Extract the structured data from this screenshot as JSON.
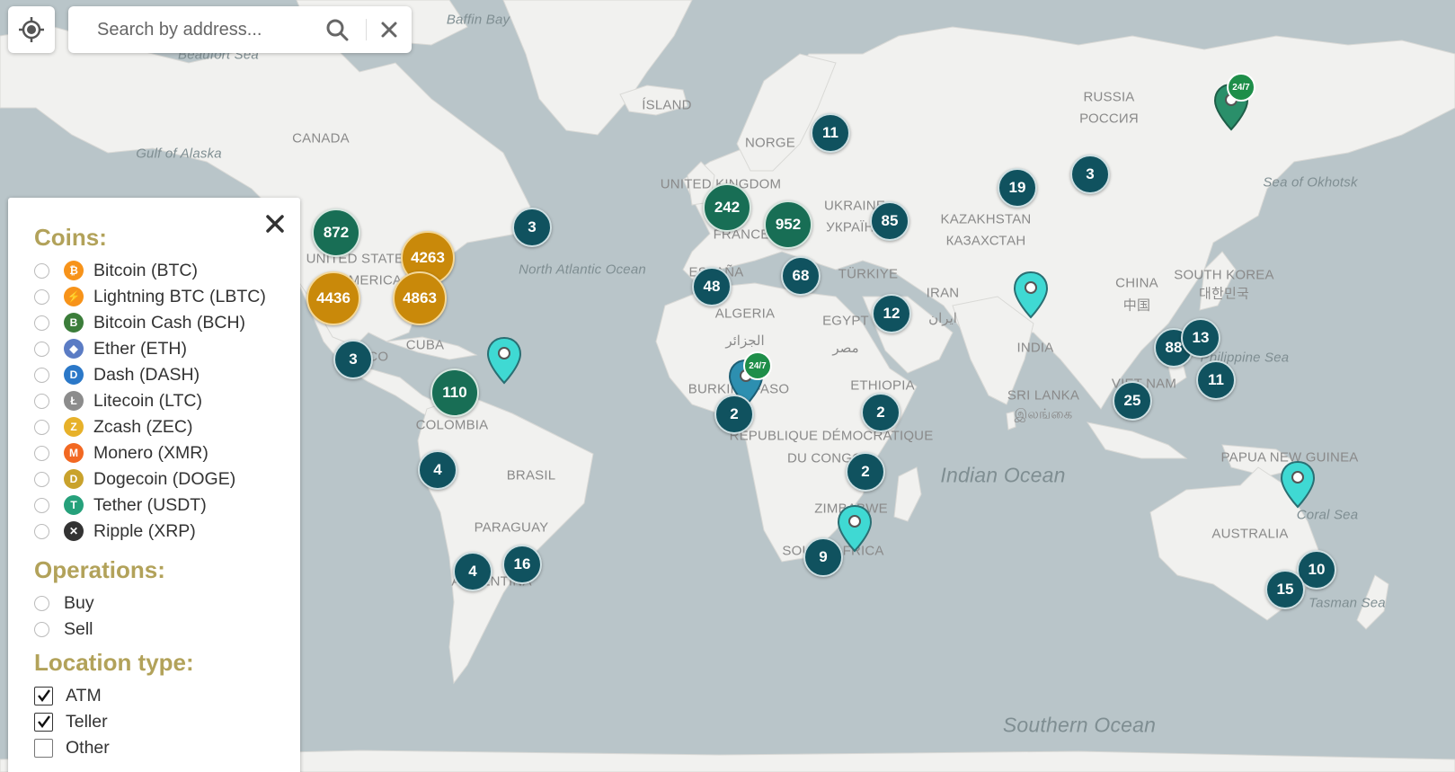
{
  "search": {
    "placeholder": "Search by address..."
  },
  "filter_panel": {
    "coins_heading": "Coins:",
    "coins": [
      {
        "label": "Bitcoin (BTC)",
        "icon": "bitcoin-icon",
        "color": "#f7931a",
        "glyph": "₿"
      },
      {
        "label": "Lightning BTC (LBTC)",
        "icon": "lightning-icon",
        "color": "#f7931a",
        "glyph": "⚡"
      },
      {
        "label": "Bitcoin Cash (BCH)",
        "icon": "bitcoin-cash-icon",
        "color": "#3b7d3a",
        "glyph": "B"
      },
      {
        "label": "Ether (ETH)",
        "icon": "ether-icon",
        "color": "#5b7cc4",
        "glyph": "◆"
      },
      {
        "label": "Dash (DASH)",
        "icon": "dash-icon",
        "color": "#2b78c8",
        "glyph": "D"
      },
      {
        "label": "Litecoin (LTC)",
        "icon": "litecoin-icon",
        "color": "#8c8c8c",
        "glyph": "Ł"
      },
      {
        "label": "Zcash (ZEC)",
        "icon": "zcash-icon",
        "color": "#e7b12a",
        "glyph": "Z"
      },
      {
        "label": "Monero (XMR)",
        "icon": "monero-icon",
        "color": "#f26822",
        "glyph": "M"
      },
      {
        "label": "Dogecoin (DOGE)",
        "icon": "dogecoin-icon",
        "color": "#c9a22c",
        "glyph": "D"
      },
      {
        "label": "Tether (USDT)",
        "icon": "tether-icon",
        "color": "#26a17b",
        "glyph": "T"
      },
      {
        "label": "Ripple (XRP)",
        "icon": "ripple-icon",
        "color": "#333333",
        "glyph": "✕"
      }
    ],
    "operations_heading": "Operations:",
    "operations": [
      {
        "label": "Buy"
      },
      {
        "label": "Sell"
      }
    ],
    "location_heading": "Location type:",
    "location_types": [
      {
        "label": "ATM",
        "checked": true
      },
      {
        "label": "Teller",
        "checked": true
      },
      {
        "label": "Other",
        "checked": false
      }
    ]
  },
  "map_labels": [
    {
      "text": "Baffin Bay",
      "kind": "sea"
    },
    {
      "text": "Beaufort Sea",
      "kind": "sea"
    },
    {
      "text": "ÍSLAND",
      "kind": "country"
    },
    {
      "text": "CANADA",
      "kind": "country"
    },
    {
      "text": "Gulf of Alaska",
      "kind": "sea"
    },
    {
      "text": "RUSSIA",
      "kind": "country"
    },
    {
      "text": "РОССИЯ",
      "kind": "country"
    },
    {
      "text": "Sea of Okhotsk",
      "kind": "sea"
    },
    {
      "text": "NORGE",
      "kind": "country"
    },
    {
      "text": "UNITED KINGDOM",
      "kind": "country"
    },
    {
      "text": "UKRAINE",
      "kind": "country"
    },
    {
      "text": "УКРАЇНА",
      "kind": "country"
    },
    {
      "text": "KAZAKHSTAN",
      "kind": "country"
    },
    {
      "text": "КАЗАХСТАН",
      "kind": "country"
    },
    {
      "text": "FRANCE",
      "kind": "country"
    },
    {
      "text": "UNITED STATES",
      "kind": "country"
    },
    {
      "text": "OF AMERICA",
      "kind": "country"
    },
    {
      "text": "North Atlantic Ocean",
      "kind": "sea"
    },
    {
      "text": "ESPAÑA",
      "kind": "country"
    },
    {
      "text": "TÜRKIYE",
      "kind": "country"
    },
    {
      "text": "CHINA",
      "kind": "country"
    },
    {
      "text": "中国",
      "kind": "country"
    },
    {
      "text": "SOUTH KOREA",
      "kind": "country"
    },
    {
      "text": "대한민국",
      "kind": "country"
    },
    {
      "text": "ALGERIA",
      "kind": "country"
    },
    {
      "text": "الجزائر",
      "kind": "country"
    },
    {
      "text": "EGYPT",
      "kind": "country"
    },
    {
      "text": "مصر",
      "kind": "country"
    },
    {
      "text": "IRAN",
      "kind": "country"
    },
    {
      "text": "ایران",
      "kind": "country"
    },
    {
      "text": "INDIA",
      "kind": "country"
    },
    {
      "text": "MEXICO",
      "kind": "country"
    },
    {
      "text": "CUBA",
      "kind": "country"
    },
    {
      "text": "Philippine Sea",
      "kind": "sea"
    },
    {
      "text": "BURKINA FASO",
      "kind": "country"
    },
    {
      "text": "ETHIOPIA",
      "kind": "country"
    },
    {
      "text": "SRI LANKA",
      "kind": "country"
    },
    {
      "text": "இலங்கை",
      "kind": "country"
    },
    {
      "text": "VIET NAM",
      "kind": "country"
    },
    {
      "text": "COLOMBIA",
      "kind": "country"
    },
    {
      "text": "RÉPUBLIQUE DÉMOCRATIQUE",
      "kind": "country"
    },
    {
      "text": "DU CONGO",
      "kind": "country"
    },
    {
      "text": "Indian Ocean",
      "kind": "ocean"
    },
    {
      "text": "BRASIL",
      "kind": "country"
    },
    {
      "text": "PAPUA NEW GUINEA",
      "kind": "country"
    },
    {
      "text": "ZIMBABWE",
      "kind": "country"
    },
    {
      "text": "Coral Sea",
      "kind": "sea"
    },
    {
      "text": "PARAGUAY",
      "kind": "country"
    },
    {
      "text": "AUSTRALIA",
      "kind": "country"
    },
    {
      "text": "SOUTH AFRICA",
      "kind": "country"
    },
    {
      "text": "ARGENTINA",
      "kind": "country"
    },
    {
      "text": "Tasman Sea",
      "kind": "sea"
    },
    {
      "text": "Southern Ocean",
      "kind": "ocean"
    }
  ],
  "clusters": [
    {
      "count": "872",
      "style": "green"
    },
    {
      "count": "4263",
      "style": "orange"
    },
    {
      "count": "4436",
      "style": "orange"
    },
    {
      "count": "4863",
      "style": "orange"
    },
    {
      "count": "3",
      "style": "teal"
    },
    {
      "count": "3",
      "style": "teal"
    },
    {
      "count": "110",
      "style": "green"
    },
    {
      "count": "4",
      "style": "teal"
    },
    {
      "count": "4",
      "style": "teal"
    },
    {
      "count": "16",
      "style": "teal"
    },
    {
      "count": "11",
      "style": "teal"
    },
    {
      "count": "242",
      "style": "green"
    },
    {
      "count": "952",
      "style": "green"
    },
    {
      "count": "85",
      "style": "teal"
    },
    {
      "count": "19",
      "style": "teal"
    },
    {
      "count": "3",
      "style": "teal"
    },
    {
      "count": "48",
      "style": "teal"
    },
    {
      "count": "68",
      "style": "teal"
    },
    {
      "count": "12",
      "style": "teal"
    },
    {
      "count": "88",
      "style": "teal"
    },
    {
      "count": "13",
      "style": "teal"
    },
    {
      "count": "11",
      "style": "teal"
    },
    {
      "count": "25",
      "style": "teal"
    },
    {
      "count": "2",
      "style": "teal"
    },
    {
      "count": "2",
      "style": "teal"
    },
    {
      "count": "2",
      "style": "teal"
    },
    {
      "count": "9",
      "style": "teal"
    },
    {
      "count": "10",
      "style": "teal"
    },
    {
      "count": "15",
      "style": "teal"
    }
  ],
  "pins": [
    {
      "color": "#3fd9d3",
      "badge": ""
    },
    {
      "color": "#2a8f6a",
      "badge": "24/7"
    },
    {
      "color": "#2d8fb0",
      "badge": "24/7"
    },
    {
      "color": "#3fd9d3",
      "badge": ""
    },
    {
      "color": "#3fd9d3",
      "badge": ""
    },
    {
      "color": "#3fd9d3",
      "badge": ""
    }
  ],
  "colors": {
    "heading": "#b2a25a",
    "cluster_teal": "#10525f",
    "cluster_green": "#186e55",
    "cluster_orange": "#c9890a",
    "water": "#b9c5c9",
    "land": "#f1f1ef"
  }
}
